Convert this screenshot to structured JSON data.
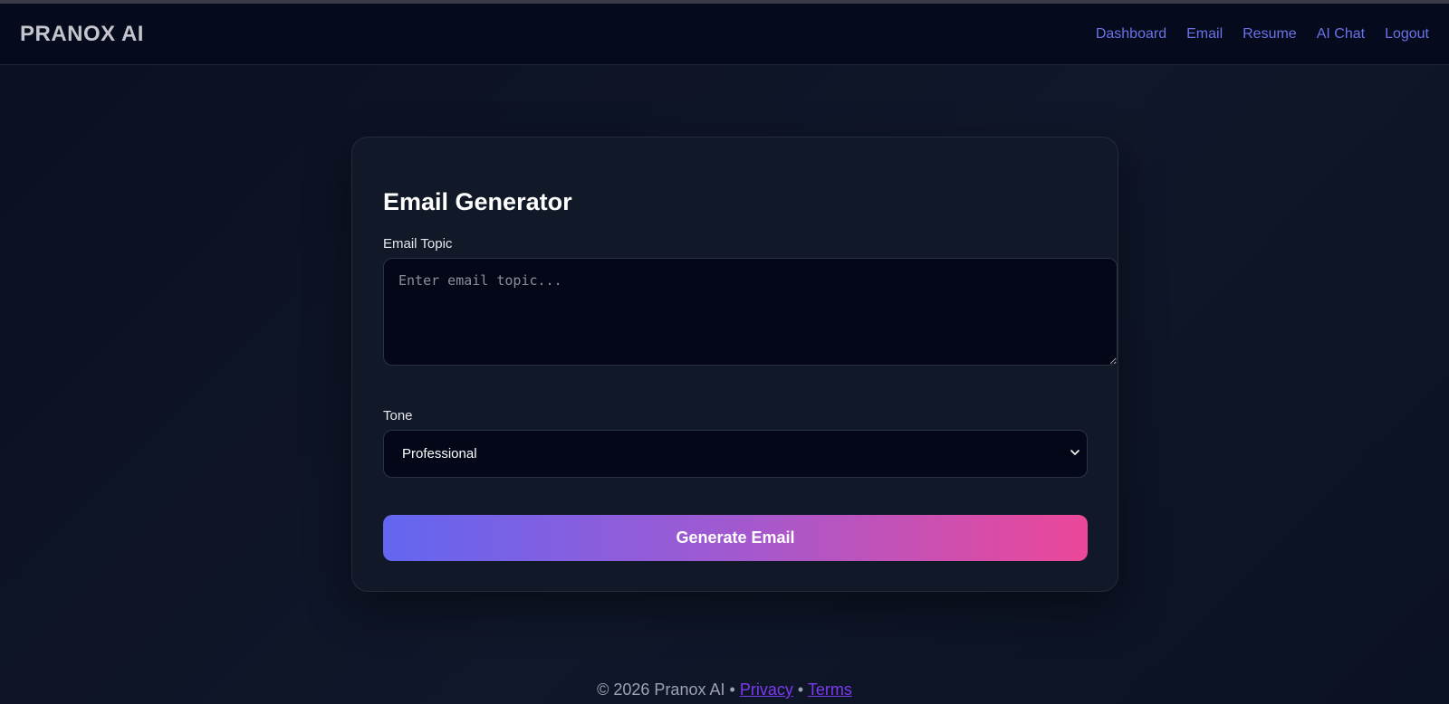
{
  "app": {
    "brand": "PRANOX AI"
  },
  "nav": {
    "items": [
      {
        "label": "Dashboard"
      },
      {
        "label": "Email"
      },
      {
        "label": "Resume"
      },
      {
        "label": "AI Chat"
      },
      {
        "label": "Logout"
      }
    ]
  },
  "card": {
    "title": "Email Generator",
    "topic": {
      "label": "Email Topic",
      "value": "",
      "placeholder": "Enter email topic..."
    },
    "tone": {
      "label": "Tone",
      "selected": "Professional"
    },
    "generate_label": "Generate Email"
  },
  "footer": {
    "copyright": "© 2026 Pranox AI",
    "separator_1": "•",
    "privacy": "Privacy",
    "separator_2": "•",
    "terms": "Terms"
  },
  "colors": {
    "background": "#0f172a",
    "navbar": "#050a1c",
    "card": "#111827",
    "nav_link": "#6b72e8",
    "gradient_start": "#6366f1",
    "gradient_end": "#ec4899",
    "footer_link": "#7c3aed"
  }
}
